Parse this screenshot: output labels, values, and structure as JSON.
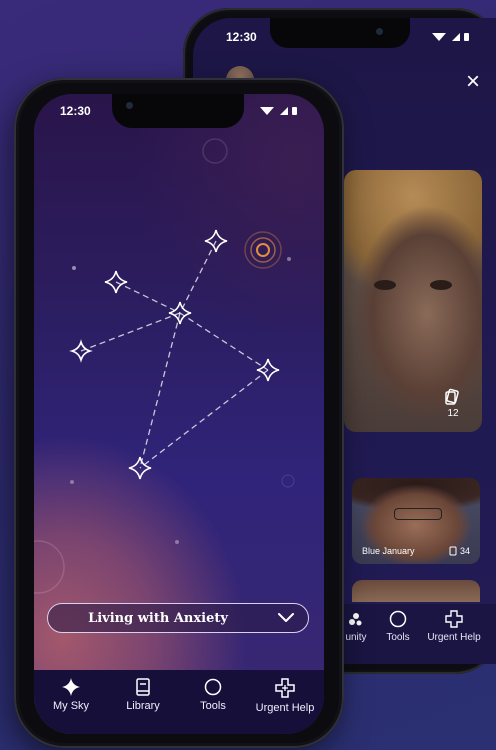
{
  "back_phone": {
    "status_time": "12:30",
    "close_label": "×",
    "video_main": {
      "count": "12",
      "count_icon": "cards-icon"
    },
    "video_small": {
      "name": "Blue January",
      "count": "34",
      "count_icon": "cards-icon"
    },
    "nav": {
      "items": [
        {
          "label": "unity",
          "icon": "community-icon"
        },
        {
          "label": "Tools",
          "icon": "circle-icon"
        },
        {
          "label": "Urgent Help",
          "icon": "cross-icon"
        }
      ]
    }
  },
  "front_phone": {
    "status_time": "12:30",
    "dropdown": {
      "selected": "Living with Anxiety"
    },
    "nav": {
      "items": [
        {
          "label": "My Sky",
          "icon": "sparkle-icon"
        },
        {
          "label": "Library",
          "icon": "book-icon"
        },
        {
          "label": "Tools",
          "icon": "circle-icon"
        },
        {
          "label": "Urgent Help",
          "icon": "cross-icon"
        }
      ]
    }
  },
  "colors": {
    "background": "#34297a",
    "accent_ring": "#e0903a",
    "nav_bg": "#160f3a",
    "star": "#ffffff"
  }
}
